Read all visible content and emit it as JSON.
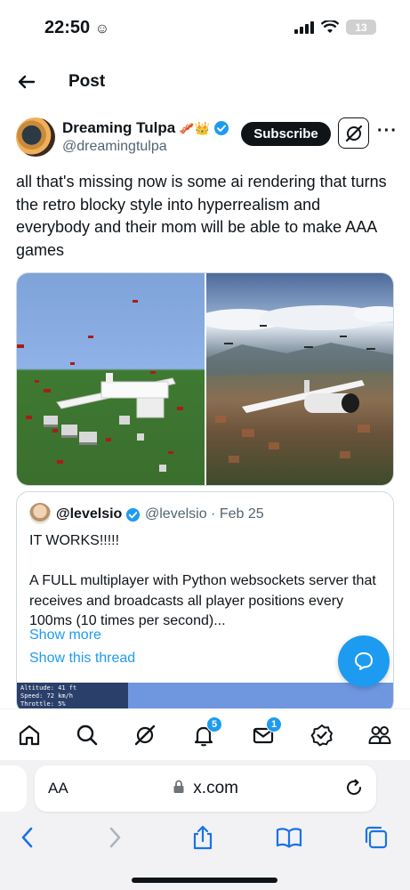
{
  "status_bar": {
    "time": "22:50",
    "battery": "13"
  },
  "header": {
    "title": "Post"
  },
  "author": {
    "name": "Dreaming Tulpa",
    "badges": "🥓👑",
    "handle": "@dreamingtulpa",
    "subscribe_label": "Subscribe"
  },
  "post": {
    "text": "all that's missing now is some ai rendering that turns the retro blocky style into hyperrealism and everybody and their mom will be able to make AAA games"
  },
  "quote": {
    "name": "@levelsio",
    "meta": "@levelsio · Feb 25",
    "line1": "IT WORKS!!!!!",
    "line2": "A FULL multiplayer with Python websockets server that receives and broadcasts all player positions every 100ms (10 times per second)...",
    "show_more": "Show more",
    "show_thread": "Show this thread",
    "hud": [
      "Altitude: 41 ft",
      "Speed: 72 km/h",
      "Throttle: 5%"
    ]
  },
  "tabs": {
    "notifications_count": "5",
    "messages_count": "1"
  },
  "browser": {
    "aa": "AA",
    "url": "x.com"
  },
  "colors": {
    "accent": "#1d9bf0",
    "text": "#0f1419",
    "muted": "#536471"
  }
}
